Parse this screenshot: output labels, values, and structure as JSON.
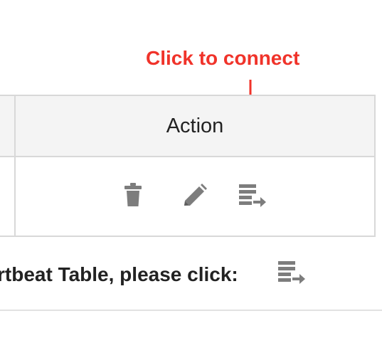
{
  "annotation": {
    "text": "Click to connect",
    "color": "#f0332a"
  },
  "table": {
    "header": {
      "action_label": "Action"
    },
    "row_actions": [
      {
        "icon": "trash-icon",
        "label": "delete"
      },
      {
        "icon": "pencil-icon",
        "label": "edit"
      },
      {
        "icon": "connect-list-icon",
        "label": "connect"
      }
    ]
  },
  "instruction": {
    "text": "rtbeat Table, please click:",
    "icon": "connect-list-icon"
  },
  "colors": {
    "icon_gray": "#7d7d7d",
    "border": "#d8d8d8",
    "header_bg": "#f4f4f4"
  }
}
